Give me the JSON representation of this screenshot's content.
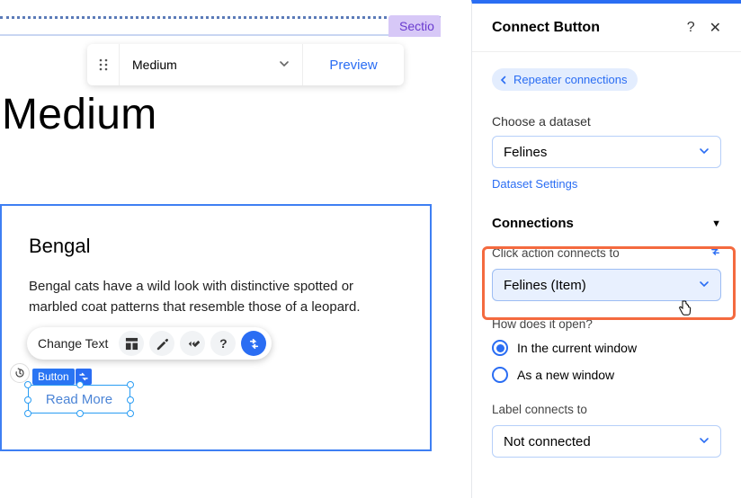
{
  "section": {
    "tag_label": "Sectio"
  },
  "toolbar": {
    "item_select": "Medium",
    "preview_label": "Preview"
  },
  "heading": "Medium",
  "card": {
    "title": "Bengal",
    "body": "Bengal cats have a wild look with distinctive spotted or marbled coat patterns that resemble those of a leopard."
  },
  "inline_toolbar": {
    "change_text": "Change Text"
  },
  "selected_element": {
    "type_label": "Button",
    "text": "Read More"
  },
  "panel": {
    "title": "Connect Button",
    "back_label": "Repeater connections",
    "choose_dataset_label": "Choose a dataset",
    "dataset_selected": "Felines",
    "dataset_settings_label": "Dataset Settings",
    "connections_header": "Connections",
    "click_action_label": "Click action connects to",
    "click_action_selected": "Felines (Item)",
    "how_open_label": "How does it open?",
    "open_options": {
      "current": "In the current window",
      "new": "As a new window"
    },
    "open_selected": "current",
    "label_connects_label": "Label connects to",
    "label_connects_selected": "Not connected"
  }
}
